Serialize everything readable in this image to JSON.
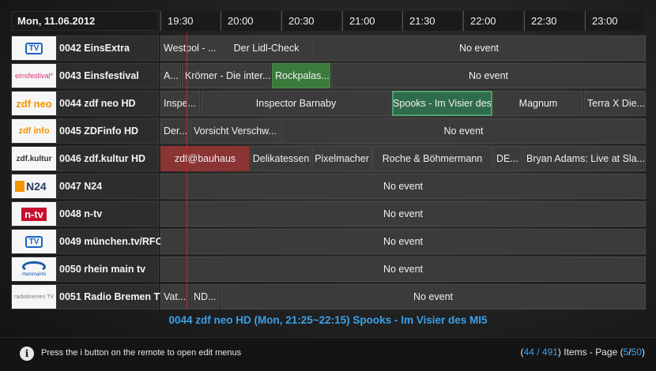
{
  "header": {
    "date": "Mon, 11.06.2012",
    "times": [
      "19:30",
      "20:00",
      "20:30",
      "21:00",
      "21:30",
      "22:00",
      "22:30",
      "23:00"
    ]
  },
  "channels": [
    {
      "name": "0042 EinsExtra",
      "logo": "TV",
      "logo_color": "#1a63c4",
      "events": [
        {
          "t": "Westpol - ..."
        },
        {
          "t": "Der Lidl-Check"
        },
        {
          "t": "No event"
        }
      ]
    },
    {
      "name": "0043 Einsfestival",
      "logo": "einsfestival*",
      "logo_color": "#e0337a",
      "events": [
        {
          "t": "A..."
        },
        {
          "t": "Krömer - Die inter..."
        },
        {
          "t": "Rockpalas..."
        },
        {
          "t": "No event"
        }
      ]
    },
    {
      "name": "0044 zdf neo HD",
      "logo": "zdf neo",
      "logo_color": "#f29400",
      "events": [
        {
          "t": "Inspe..."
        },
        {
          "t": "Inspector Barnaby"
        },
        {
          "t": "Spooks - Im Visier des"
        },
        {
          "t": "Magnum"
        },
        {
          "t": "Terra X Die..."
        }
      ]
    },
    {
      "name": "0045 ZDFinfo HD",
      "logo": "zdf info",
      "logo_color": "#f29400",
      "events": [
        {
          "t": "Der..."
        },
        {
          "t": "Vorsicht Verschw..."
        },
        {
          "t": "No event"
        }
      ]
    },
    {
      "name": "0046 zdf.kultur HD",
      "logo": "zdf.kultur",
      "logo_color": "#333333",
      "events": [
        {
          "t": "zdf@bauhaus"
        },
        {
          "t": "Delikatessen"
        },
        {
          "t": "Pixelmacher"
        },
        {
          "t": "Roche & Böhmermann"
        },
        {
          "t": "DE..."
        },
        {
          "t": "Bryan Adams: Live at Sla..."
        }
      ]
    },
    {
      "name": "0047 N24",
      "logo": "N24",
      "logo_color": "#2a3d5c",
      "events": [
        {
          "t": "No event"
        }
      ]
    },
    {
      "name": "0048 n-tv",
      "logo": "n-tv",
      "logo_color": "#c8102e",
      "events": [
        {
          "t": "No event"
        }
      ]
    },
    {
      "name": "0049 münchen.tv/RFO",
      "logo": "TV",
      "logo_color": "#1a63c4",
      "events": [
        {
          "t": "No event"
        }
      ]
    },
    {
      "name": "0050 rhein main tv",
      "logo": "rheinmaintv",
      "logo_color": "#1a5aa8",
      "events": [
        {
          "t": "No event"
        }
      ]
    },
    {
      "name": "0051 Radio Bremen TV",
      "logo": "radiobremen TV",
      "logo_color": "#7a7a7a",
      "events": [
        {
          "t": "Vat..."
        },
        {
          "t": "ND..."
        },
        {
          "t": "No event"
        }
      ]
    }
  ],
  "selected_info": "0044 zdf neo HD (Mon, 21:25~22:15) Spooks - Im Visier des MI5",
  "footer": {
    "hint": "Press the i button on the remote to open edit menus",
    "pager_open": "(",
    "current_item": "44",
    "slash": " / ",
    "total_items": "491",
    "pager_mid": ") Items - Page (",
    "current_page": "5",
    "page_slash": "/",
    "total_pages": "50",
    "pager_close": ")"
  },
  "colors": {
    "accent": "#3aa0e8",
    "now_line": "#c0282a",
    "highlight_green": "#3a7a3a",
    "selected_green": "#2f6b4d",
    "highlight_red": "#8a3434"
  }
}
